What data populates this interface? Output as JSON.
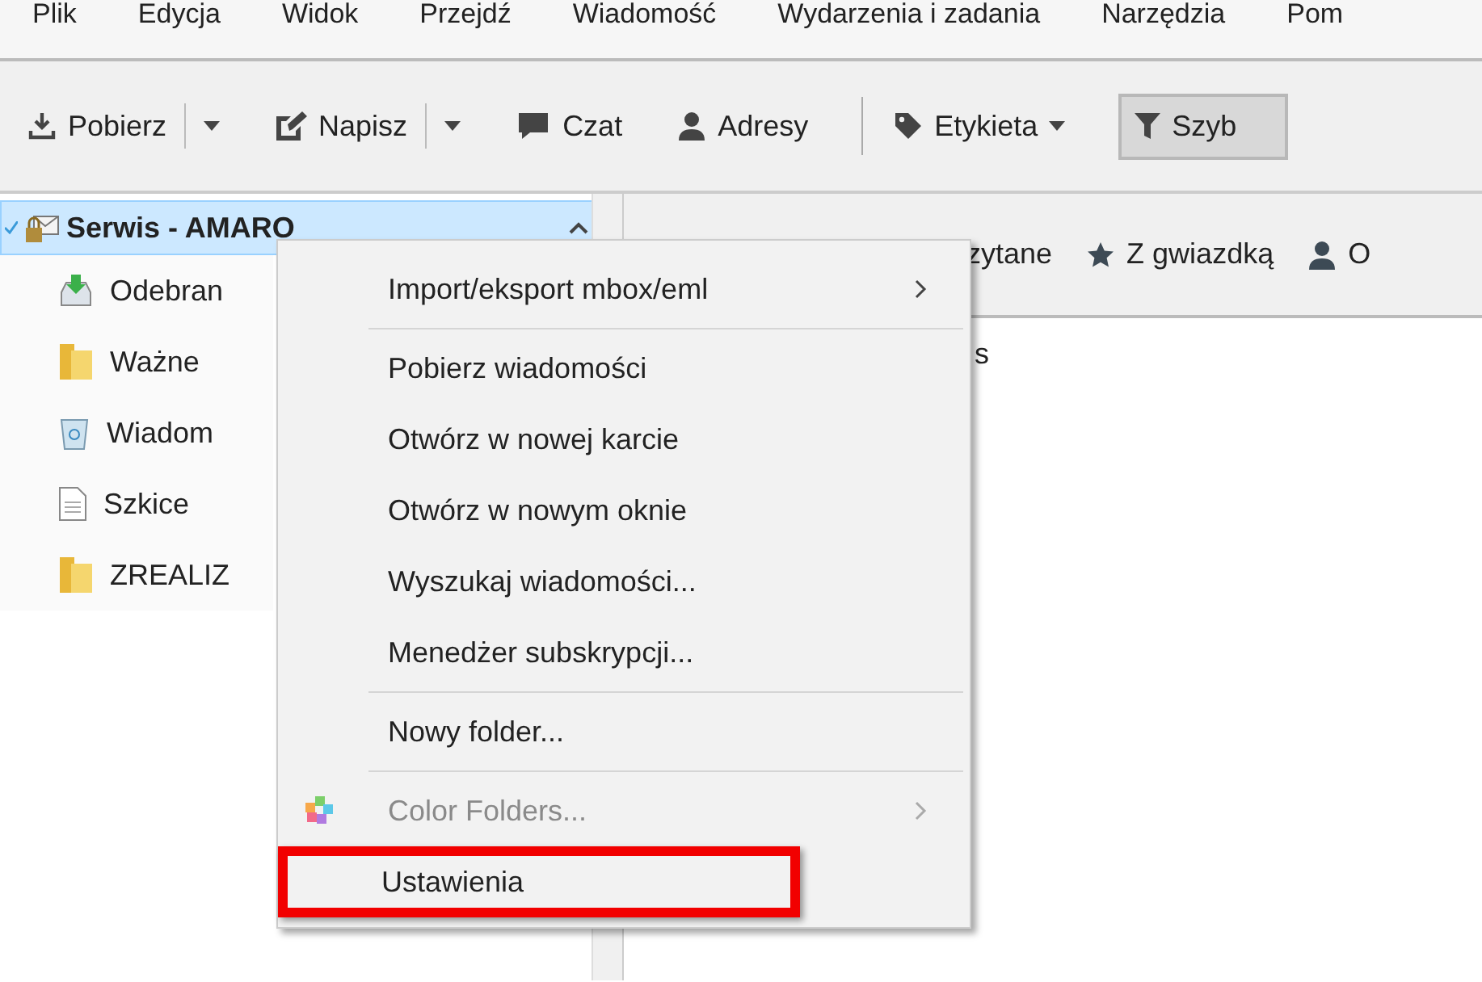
{
  "menubar": [
    "Plik",
    "Edycja",
    "Widok",
    "Przejdź",
    "Wiadomość",
    "Wydarzenia i zadania",
    "Narzędzia",
    "Pom"
  ],
  "toolbar": [
    {
      "label": "Pobierz",
      "kind": "split"
    },
    {
      "label": "Napisz",
      "kind": "split"
    },
    {
      "label": "Czat",
      "kind": "button"
    },
    {
      "label": "Adresy",
      "kind": "button"
    },
    {
      "kind": "divider"
    },
    {
      "label": "Etykieta",
      "kind": "dropdown"
    },
    {
      "label": "Szyb",
      "kind": "toggle",
      "pressed": true
    }
  ],
  "folders": {
    "account": {
      "name": "Serwis - AMARO",
      "selected": true,
      "expanded": true
    },
    "items": [
      {
        "name": "Odebran",
        "kind": "inbox"
      },
      {
        "name": "Ważne",
        "kind": "folder"
      },
      {
        "name": "Wiadom",
        "kind": "trash"
      },
      {
        "name": "Szkice",
        "kind": "drafts"
      },
      {
        "name": "ZREALIZ",
        "kind": "folder"
      }
    ]
  },
  "quick_filter": [
    {
      "label": "zytane"
    },
    {
      "label": "Z gwiazdką"
    },
    {
      "label": "O"
    }
  ],
  "message_list": {
    "column_1": "s"
  },
  "context_menu": [
    {
      "kind": "item",
      "label": "Import/eksport mbox/eml",
      "submenu": true,
      "disabled": false,
      "highlighted": false
    },
    {
      "kind": "separator"
    },
    {
      "kind": "item",
      "label": "Pobierz wiadomości",
      "submenu": false,
      "disabled": false,
      "highlighted": false
    },
    {
      "kind": "item",
      "label": "Otwórz w nowej karcie",
      "submenu": false,
      "disabled": false,
      "highlighted": false
    },
    {
      "kind": "item",
      "label": "Otwórz w nowym oknie",
      "submenu": false,
      "disabled": false,
      "highlighted": false
    },
    {
      "kind": "item",
      "label": "Wyszukaj wiadomości...",
      "submenu": false,
      "disabled": false,
      "highlighted": false
    },
    {
      "kind": "item",
      "label": "Menedżer subskrypcji...",
      "submenu": false,
      "disabled": false,
      "highlighted": false
    },
    {
      "kind": "separator"
    },
    {
      "kind": "item",
      "label": "Nowy folder...",
      "submenu": false,
      "disabled": false,
      "highlighted": false
    },
    {
      "kind": "separator"
    },
    {
      "kind": "item",
      "label": "Color Folders...",
      "submenu": true,
      "disabled": true,
      "highlighted": false
    },
    {
      "kind": "item",
      "label": "Ustawienia",
      "submenu": false,
      "disabled": false,
      "highlighted": true
    }
  ]
}
